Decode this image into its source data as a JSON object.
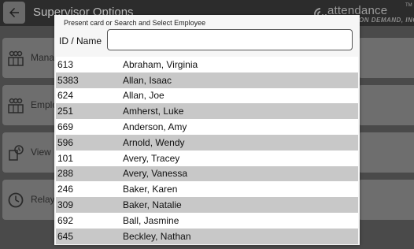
{
  "header": {
    "title": "Supervisor Options"
  },
  "logo": {
    "main": "attendance",
    "sup": "TM",
    "sub": "ON DEMAND, INC."
  },
  "menu": {
    "items": [
      {
        "label": "Manag",
        "icon": "manage-icon"
      },
      {
        "label": "Emplo",
        "icon": "employees-icon"
      },
      {
        "label": "View (",
        "icon": "view-icon"
      },
      {
        "label": "Relay",
        "icon": "clock-icon"
      }
    ]
  },
  "dialog": {
    "instruction": "Present card or Search and Select Employee",
    "id_label": "ID / Name",
    "search_value": "",
    "employees": [
      {
        "id": "613",
        "name": "Abraham, Virginia"
      },
      {
        "id": "5383",
        "name": "Allan, Isaac"
      },
      {
        "id": "624",
        "name": "Allan, Joe"
      },
      {
        "id": "251",
        "name": "Amherst, Luke"
      },
      {
        "id": "669",
        "name": "Anderson, Amy"
      },
      {
        "id": "596",
        "name": "Arnold, Wendy"
      },
      {
        "id": "101",
        "name": "Avery, Tracey"
      },
      {
        "id": "288",
        "name": "Avery, Vanessa"
      },
      {
        "id": "246",
        "name": "Baker, Karen"
      },
      {
        "id": "309",
        "name": "Baker, Natalie"
      },
      {
        "id": "692",
        "name": "Ball, Jasmine"
      },
      {
        "id": "645",
        "name": "Beckley, Nathan"
      }
    ]
  }
}
